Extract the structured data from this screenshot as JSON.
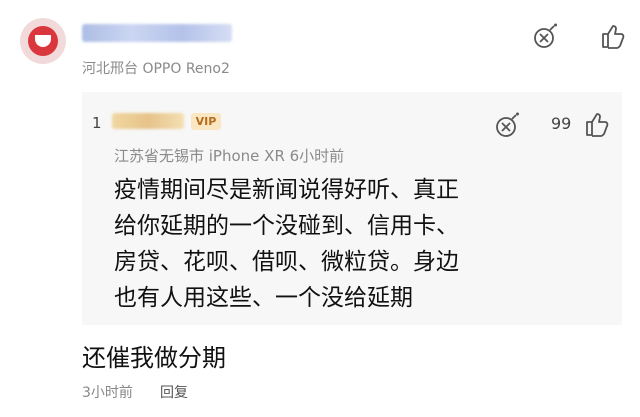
{
  "comment": {
    "location": "河北邢台  OPPO Reno2",
    "text": "还催我做分期",
    "time": "3小时前",
    "reply_label": "回复"
  },
  "reply": {
    "index": "1",
    "vip_label": "VIP",
    "like_count": "99",
    "location": "江苏省无锡市  iPhone XR  6小时前",
    "lines": [
      "疫情期间尽是新闻说得好听、真正",
      "给你延期的一个没碰到、信用卡、",
      "房贷、花呗、借呗、微粒贷。身边",
      "也有人用这些、一个没给延期"
    ]
  },
  "icons": {
    "bomb": "bomb-icon",
    "thumb": "thumbs-up-icon"
  }
}
